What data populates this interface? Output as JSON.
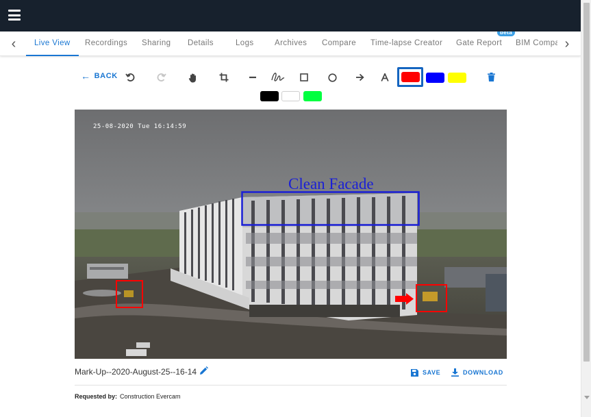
{
  "tabs": [
    {
      "label": "Live View",
      "active": true
    },
    {
      "label": "Recordings"
    },
    {
      "label": "Sharing"
    },
    {
      "label": "Details"
    },
    {
      "label": "Logs"
    },
    {
      "label": "Archives"
    },
    {
      "label": "Compare"
    },
    {
      "label": "Time-lapse Creator"
    },
    {
      "label": "Gate Report",
      "badge": "beta"
    },
    {
      "label": "BIM Compa"
    }
  ],
  "toolbar": {
    "back_label": "BACK",
    "tools": [
      "undo-icon",
      "redo-icon",
      "pan-hand-icon",
      "crop-icon",
      "line-icon",
      "freehand-icon",
      "rectangle-icon",
      "circle-icon",
      "arrow-icon",
      "text-icon"
    ],
    "colors": {
      "selected": "#ff0000",
      "palette_row1": [
        "#ff0000",
        "#0000ff",
        "#ffff00"
      ],
      "palette_row2": [
        "#000000",
        "#ffffff",
        "#00ff40"
      ]
    },
    "delete_icon": "trash-icon"
  },
  "image": {
    "timestamp": "25-08-2020 Tue 16:14:59",
    "annotation_text": "Clean Facade"
  },
  "footer": {
    "file_name": "Mark-Up--2020-August-25--16-14",
    "save_label": "SAVE",
    "download_label": "DOWNLOAD",
    "requested_by_label": "Requested by:",
    "requested_by_value": "Construction Evercam"
  },
  "theme": {
    "topbar": "#17212d",
    "accent": "#1976d2",
    "annotation_blue": "#1a1fd6",
    "annotation_red": "#ff0000"
  }
}
